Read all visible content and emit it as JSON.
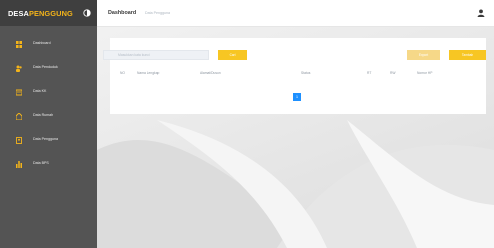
{
  "brand": {
    "part1": "DESA",
    "part2": "PENGGUNG"
  },
  "sidebar": {
    "items": [
      {
        "label": "Dashboard",
        "icon": "dashboard-icon"
      },
      {
        "label": "Data Penduduk",
        "icon": "users-icon"
      },
      {
        "label": "Data KK",
        "icon": "card-icon"
      },
      {
        "label": "Data Rumah",
        "icon": "home-icon"
      },
      {
        "label": "Data Pengguna",
        "icon": "user-icon"
      },
      {
        "label": "Data BPS",
        "icon": "chart-icon"
      }
    ]
  },
  "topbar": {
    "title": "Dashboard",
    "crumb": "Data Pengguna"
  },
  "search": {
    "placeholder": "Masukkan kata kunci"
  },
  "buttons": {
    "find": "Cari",
    "export": "Export",
    "add": "Tambah"
  },
  "table": {
    "headers": [
      "NO",
      "Nama Lengkap",
      "Alamat/Dusun",
      "Status",
      "RT",
      "RW",
      "Nomor HP"
    ]
  },
  "pagination": {
    "current": "1"
  },
  "colors": {
    "accent": "#f7c623",
    "sidebar": "#545454",
    "brand_accent": "#f4b41a",
    "pager": "#1e90ff"
  }
}
